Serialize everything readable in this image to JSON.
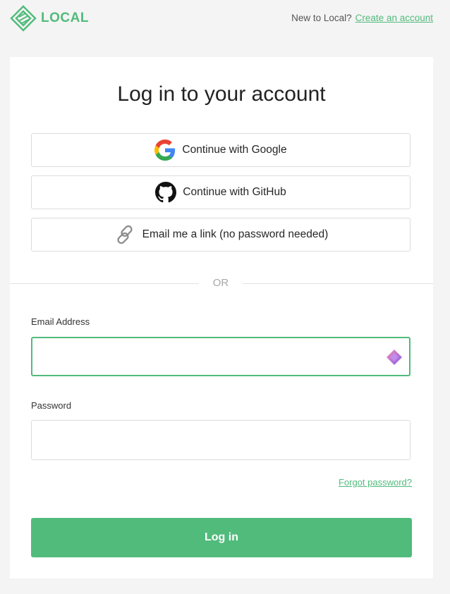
{
  "brand": {
    "name": "LOCAL",
    "color": "#51bb7b"
  },
  "header": {
    "prompt": "New to Local?",
    "signup_link": "Create an account"
  },
  "login": {
    "title": "Log in to your account",
    "google_label": "Continue with Google",
    "github_label": "Continue with GitHub",
    "email_link_label": "Email me a link (no password needed)",
    "or_text": "OR",
    "email_label": "Email Address",
    "email_value": "",
    "password_label": "Password",
    "password_value": "",
    "forgot_label": "Forgot password?",
    "submit_label": "Log in"
  },
  "icons": {
    "logo": "local-logo-icon",
    "google": "google-icon",
    "github": "github-icon",
    "link": "link-icon",
    "password_manager": "password-manager-icon"
  }
}
